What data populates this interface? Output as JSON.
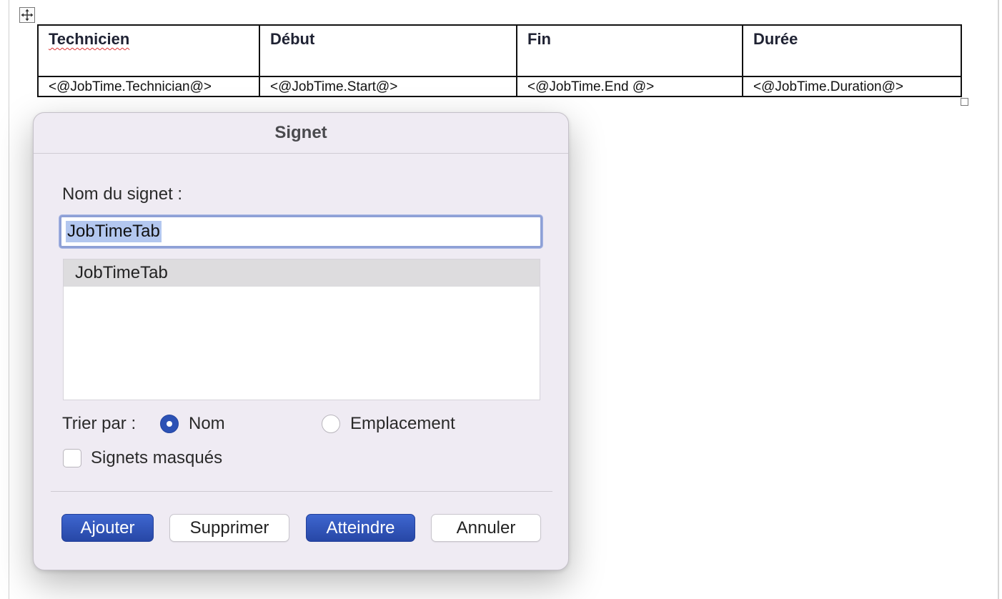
{
  "table": {
    "headers": [
      "Technicien",
      "Début",
      "Fin",
      "Durée"
    ],
    "row": [
      "<@JobTime.Technician@>",
      "<@JobTime.Start@>",
      "<@JobTime.End @>",
      "<@JobTime.Duration@>"
    ]
  },
  "dialog": {
    "title": "Signet",
    "name_label": "Nom du signet :",
    "name_value": "JobTimeTab",
    "list_items": [
      "JobTimeTab"
    ],
    "sort_label": "Trier par :",
    "sort_options": [
      {
        "label": "Nom",
        "selected": true
      },
      {
        "label": "Emplacement",
        "selected": false
      }
    ],
    "hidden_label": "Signets masqués",
    "hidden_checked": false,
    "buttons": {
      "add": "Ajouter",
      "delete": "Supprimer",
      "goto": "Atteindre",
      "cancel": "Annuler"
    }
  },
  "colors": {
    "primary_button": "#2c52b5",
    "dialog_bg": "#efebf3",
    "selection": "#b3c7ef"
  },
  "icons": [
    "move-icon",
    "resize-handle-icon"
  ]
}
